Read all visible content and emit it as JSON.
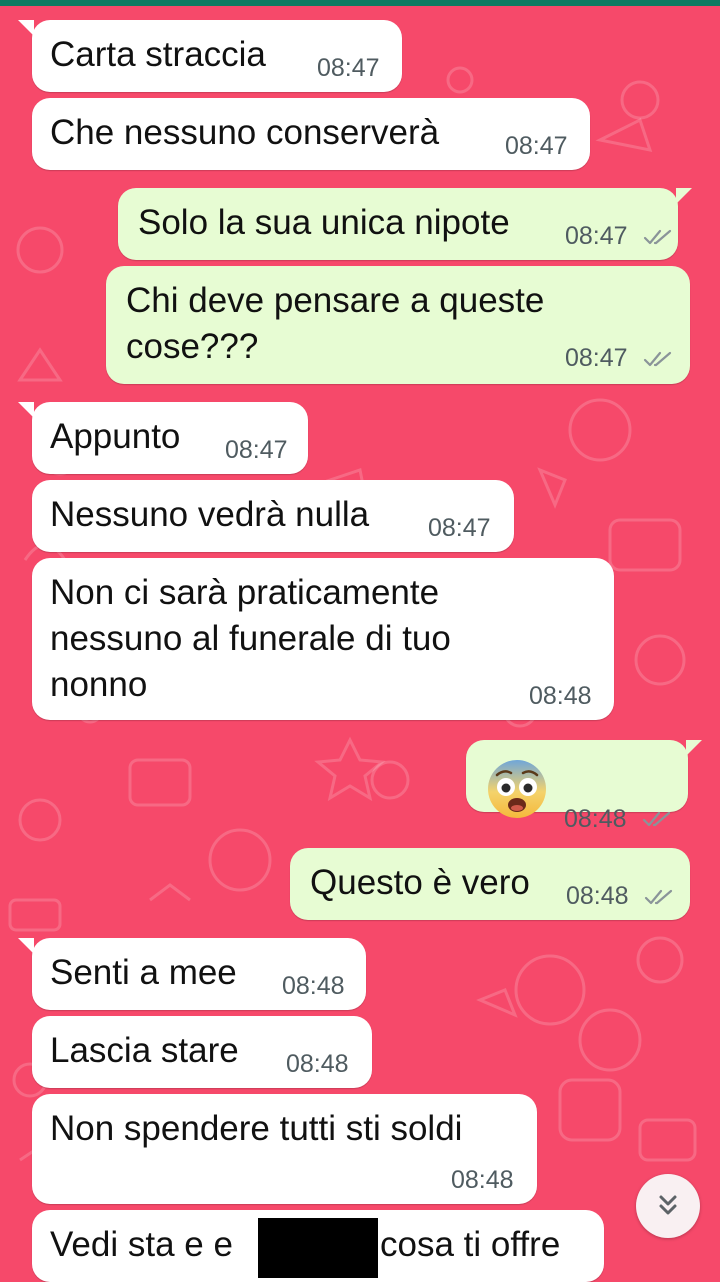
{
  "messages": [
    {
      "dir": "in",
      "text": "Carta straccia",
      "time": "08:47"
    },
    {
      "dir": "in",
      "text": "Che nessuno conserverà",
      "time": "08:47"
    },
    {
      "dir": "out",
      "text": "Solo la sua unica nipote",
      "time": "08:47",
      "status": "read"
    },
    {
      "dir": "out",
      "lines": [
        "Chi deve pensare a queste",
        "cose???"
      ],
      "time": "08:47",
      "status": "read"
    },
    {
      "dir": "in",
      "text": "Appunto",
      "time": "08:47"
    },
    {
      "dir": "in",
      "text": "Nessuno vedrà nulla",
      "time": "08:47"
    },
    {
      "dir": "in",
      "lines": [
        "Non ci sarà praticamente",
        "nessuno al funerale di tuo",
        "nonno"
      ],
      "time": "08:48"
    },
    {
      "dir": "out",
      "emoji": "😨",
      "emoji_name": "fearful-face",
      "time": "08:48",
      "status": "read"
    },
    {
      "dir": "out",
      "text": "Questo è vero",
      "time": "08:48",
      "status": "read"
    },
    {
      "dir": "in",
      "text": "Senti a mee",
      "time": "08:48"
    },
    {
      "dir": "in",
      "text": "Lascia stare",
      "time": "08:48"
    },
    {
      "dir": "in",
      "text": "Non spendere tutti sti soldi",
      "time": "08:48"
    },
    {
      "dir": "in",
      "text_before": "Vedi sta e e",
      "text_after": "cosa ti offre"
    }
  ],
  "scroll_button": {
    "icon": "double-chevron-down-icon"
  },
  "colors": {
    "background": "#f6496a",
    "incoming": "#ffffff",
    "outgoing": "#e7fcd3",
    "ticks": "#8a9499",
    "topbar": "#0e7a62"
  }
}
